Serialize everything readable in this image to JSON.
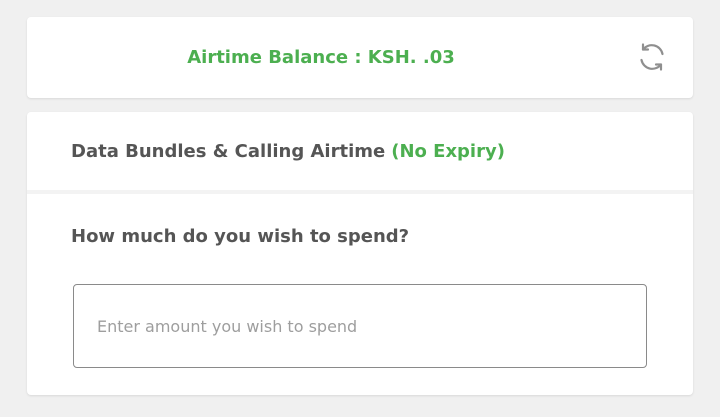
{
  "balance": {
    "label": "Airtime Balance : KSH. .03",
    "refresh_icon": "refresh-icon"
  },
  "bundle": {
    "title": "Data Bundles & Calling Airtime",
    "expiry_note": "(No Expiry)",
    "question": "How much do you wish to spend?",
    "amount_input": {
      "value": "",
      "placeholder": "Enter amount you wish to spend"
    }
  },
  "colors": {
    "accent_green": "#4caf50",
    "text_gray": "#555555",
    "page_background": "#f0f0f0",
    "card_background": "#ffffff"
  }
}
